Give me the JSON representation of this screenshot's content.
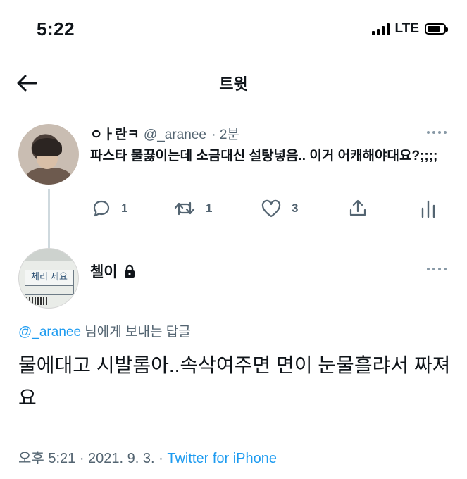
{
  "status_bar": {
    "time": "5:22",
    "network": "LTE",
    "signal_bars": 4,
    "battery_level": 0.8
  },
  "nav": {
    "back_icon": "arrow-left-icon",
    "title": "트윗"
  },
  "parent_tweet": {
    "display_name": "ㅇㅏ란ㅋ",
    "handle": "@_aranee",
    "time": "· 2분",
    "text": "파스타 물끓이는데 소금대신 설탕넣음.. 이거 어캐해야대요?;;;;",
    "actions": {
      "reply_count": "1",
      "retweet_count": "1",
      "like_count": "3"
    }
  },
  "reply_tweet": {
    "display_name": "첼이",
    "protected_icon": "lock-icon",
    "avatar_text": "체리 세요",
    "replying_to_mention": "@_aranee",
    "replying_to_suffix": " 님에게 보내는 답글",
    "text": "물에대고 시발롬아..속삭여주면 면이 눈물흘랴서 짜져요",
    "timestamp": "오후 5:21 · 2021. 9. 3. · ",
    "source": "Twitter for iPhone"
  },
  "colors": {
    "link": "#1d9bf0",
    "secondary_text": "#536471",
    "thread_line": "#cfd9de"
  }
}
